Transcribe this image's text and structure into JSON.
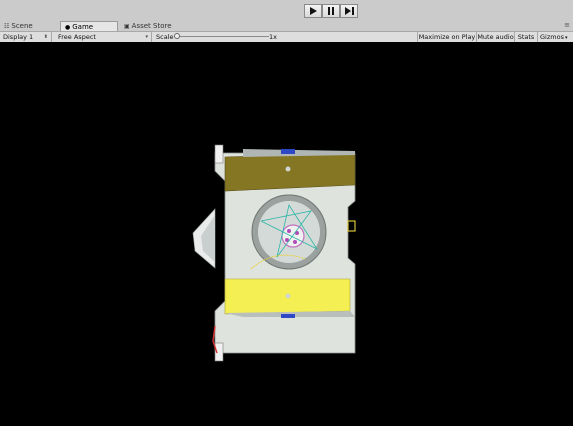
{
  "playbar": {
    "play_icon": "play-icon",
    "pause_icon": "pause-icon",
    "step_icon": "step-forward-icon"
  },
  "tabs": [
    {
      "label": "Scene",
      "icon": "scene-grid-icon"
    },
    {
      "label": "Game",
      "icon": "game-controller-icon",
      "active": true
    },
    {
      "label": "Asset Store",
      "icon": "store-icon"
    }
  ],
  "tab_menu_glyph": "≡",
  "toolbar": {
    "display": "Display 1",
    "aspect": "Free Aspect",
    "scale_label": "Scale",
    "scale_value": "1x",
    "maximize_on_play": "Maximize on Play",
    "mute_audio": "Mute audio",
    "stats": "Stats",
    "gizmos": "Gizmos"
  },
  "colors": {
    "editor_bg": "#cbcbcb",
    "viewport_bg": "#000000",
    "panel_yellow": "#f4ef52",
    "panel_olive": "#857624",
    "body_grey": "#dfe3dd"
  }
}
